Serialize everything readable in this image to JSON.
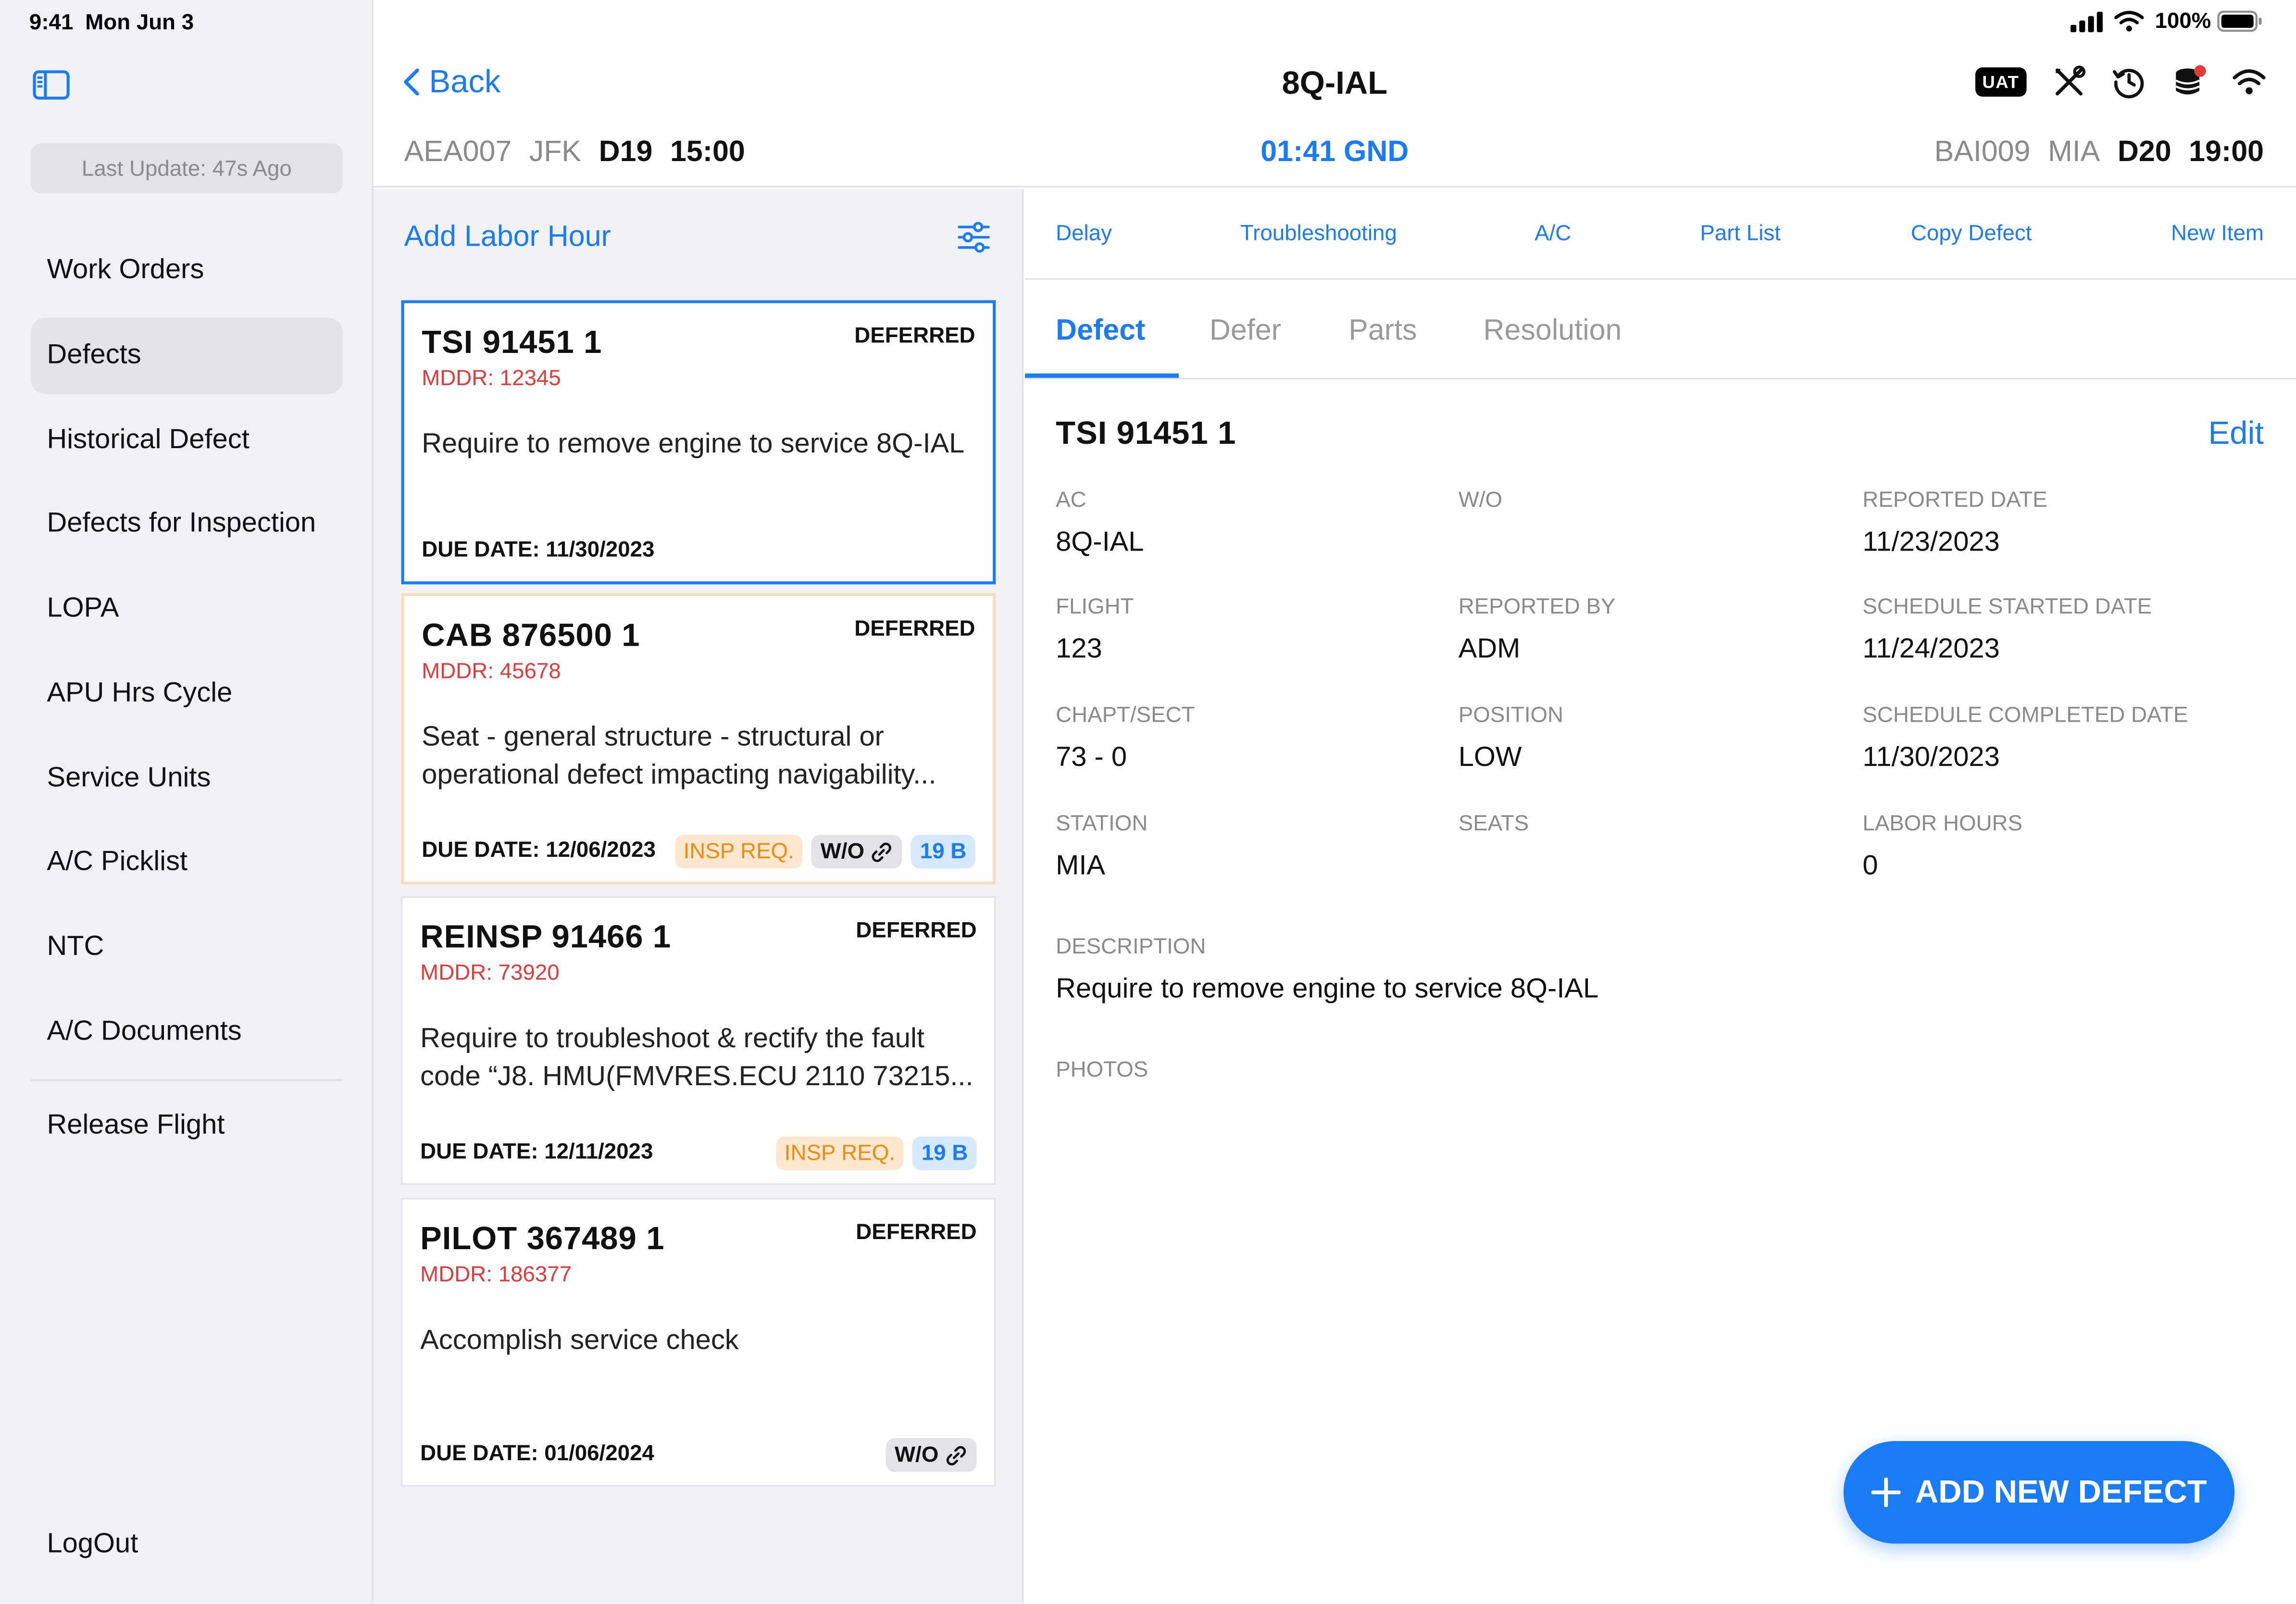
{
  "status": {
    "time": "9:41",
    "date": "Mon Jun 3",
    "battery": "100%"
  },
  "sidebar": {
    "last_update": "Last Update: 47s Ago",
    "items": [
      {
        "label": "Work Orders"
      },
      {
        "label": "Defects"
      },
      {
        "label": "Historical Defect"
      },
      {
        "label": "Defects for Inspection"
      },
      {
        "label": "LOPA"
      },
      {
        "label": "APU Hrs Cycle"
      },
      {
        "label": "Service Units"
      },
      {
        "label": "A/C Picklist"
      },
      {
        "label": "NTC"
      },
      {
        "label": "A/C Documents"
      }
    ],
    "release_flight": "Release Flight",
    "logout": "LogOut"
  },
  "header": {
    "back": "Back",
    "title": "8Q-IAL",
    "uat": "UAT",
    "inbound": {
      "flight": "AEA007",
      "airport": "JFK",
      "gate": "D19",
      "time": "15:00"
    },
    "ground_time": "01:41 GND",
    "outbound": {
      "flight": "BAI009",
      "airport": "MIA",
      "gate": "D20",
      "time": "19:00"
    }
  },
  "list": {
    "add_labor": "Add Labor Hour",
    "cards": [
      {
        "title": "TSI   91451   1",
        "status": "DEFERRED",
        "mddr": "MDDR: 12345",
        "desc": "Require to remove engine to service 8Q-IAL",
        "due": "DUE DATE: 11/30/2023"
      },
      {
        "title": "CAB   876500   1",
        "status": "DEFERRED",
        "mddr": "MDDR: 45678",
        "desc": "Seat - general structure - structural or operational defect impacting navigability...",
        "due": "DUE DATE: 12/06/2023",
        "insp": "INSP REQ.",
        "wo": "W/O",
        "count": "19 B"
      },
      {
        "title": "REINSP   91466   1",
        "status": "DEFERRED",
        "mddr": "MDDR: 73920",
        "desc": "Require to troubleshoot & rectify the fault code “J8. HMU(FMVRES.ECU 2110 73215...",
        "due": "DUE DATE: 12/11/2023",
        "insp": "INSP REQ.",
        "count": "19 B"
      },
      {
        "title": "PILOT   367489   1",
        "status": "DEFERRED",
        "mddr": "MDDR: 186377",
        "desc": "Accomplish service check",
        "due": "DUE DATE: 01/06/2024",
        "wo": "W/O"
      }
    ]
  },
  "detail": {
    "actions": [
      "Delay",
      "Troubleshooting",
      "A/C",
      "Part List",
      "Copy Defect",
      "New Item"
    ],
    "tabs": [
      "Defect",
      "Defer",
      "Parts",
      "Resolution"
    ],
    "title": "TSI   91451   1",
    "edit": "Edit",
    "fields": {
      "ac": {
        "label": "AC",
        "value": "8Q-IAL"
      },
      "wo": {
        "label": "W/O",
        "value": ""
      },
      "reported_date": {
        "label": "REPORTED DATE",
        "value": "11/23/2023"
      },
      "flight": {
        "label": "FLIGHT",
        "value": "123"
      },
      "reported_by": {
        "label": "REPORTED BY",
        "value": "ADM"
      },
      "schedule_started": {
        "label": "SCHEDULE STARTED DATE",
        "value": "11/24/2023"
      },
      "chapt_sect": {
        "label": "CHAPT/SECT",
        "value": "73 - 0"
      },
      "position": {
        "label": "POSITION",
        "value": "LOW"
      },
      "schedule_completed": {
        "label": "SCHEDULE COMPLETED DATE",
        "value": "11/30/2023"
      },
      "station": {
        "label": "STATION",
        "value": "MIA"
      },
      "seats": {
        "label": "SEATS",
        "value": ""
      },
      "labor_hours": {
        "label": "LABOR HOURS",
        "value": "0"
      },
      "description": {
        "label": "DESCRIPTION",
        "value": "Require to remove engine to service 8Q-IAL"
      },
      "photos": {
        "label": "PHOTOS"
      }
    },
    "add_new_defect": "ADD NEW DEFECT"
  },
  "colors": {
    "accent": "#1a7cf5",
    "mddr": "#e5393a",
    "insp": "#f28a11"
  }
}
